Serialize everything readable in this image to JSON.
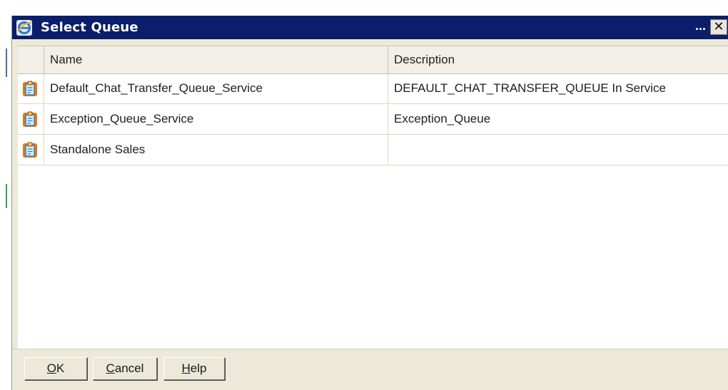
{
  "window": {
    "title": "Select Queue",
    "title_menu_glyph": "...",
    "close_glyph": "✕",
    "title_icon": "internet-explorer-icon"
  },
  "table": {
    "columns": [
      "Name",
      "Description"
    ],
    "rows": [
      {
        "icon": "queue-icon",
        "name": "Default_Chat_Transfer_Queue_Service",
        "description": "DEFAULT_CHAT_TRANSFER_QUEUE In Service"
      },
      {
        "icon": "queue-icon",
        "name": "Exception_Queue_Service",
        "description": "Exception_Queue"
      },
      {
        "icon": "queue-icon",
        "name": "Standalone Sales",
        "description": ""
      }
    ]
  },
  "buttons": {
    "ok": {
      "accel": "O",
      "rest": "K"
    },
    "cancel": {
      "accel": "C",
      "rest": "ancel"
    },
    "help": {
      "accel": "H",
      "rest": "elp"
    }
  },
  "colors": {
    "titlebar": "#0a1e6b",
    "dialog_bg": "#ece9d8",
    "header_bg": "#f1efe7",
    "icon_orange": "#e07a10",
    "icon_blue": "#2f7fd0"
  }
}
